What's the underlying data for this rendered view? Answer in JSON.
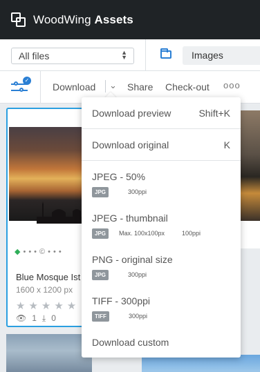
{
  "header": {
    "brand_light": "WoodWing",
    "brand_bold": "Assets"
  },
  "filterbar": {
    "scope_value": "All files",
    "location_value": "Images"
  },
  "actionbar": {
    "download_label": "Download",
    "share_label": "Share",
    "checkout_label": "Check-out",
    "more_label": "ooo"
  },
  "card": {
    "name": "Blue Mosque Ist",
    "dimensions": "1600 x 1200 px",
    "rating": 0,
    "views": "1",
    "downloads": "0"
  },
  "download_menu": {
    "preview_label": "Download preview",
    "preview_shortcut": "Shift+K",
    "original_label": "Download original",
    "original_shortcut": "K",
    "presets": [
      {
        "label": "JPEG - 50%",
        "format": "JPG",
        "size": "",
        "resolution": "300ppi"
      },
      {
        "label": "JPEG - thumbnail",
        "format": "JPG",
        "size": "Max. 100x100px",
        "resolution": "100ppi"
      },
      {
        "label": "PNG - original size",
        "format": "JPG",
        "size": "",
        "resolution": "300ppi"
      },
      {
        "label": "TIFF - 300ppi",
        "format": "TIFF",
        "size": "",
        "resolution": "300ppi"
      }
    ],
    "custom_label": "Download custom"
  },
  "colors": {
    "accent": "#2a7fd4",
    "selection": "#2a9fe0",
    "topbar": "#1f2326",
    "tag": "#2fae59"
  }
}
